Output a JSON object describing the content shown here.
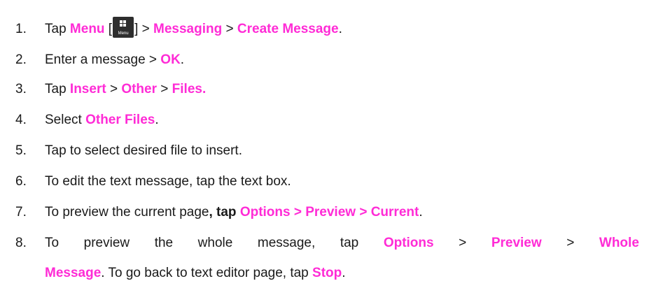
{
  "steps": [
    {
      "n": "1.",
      "t1": "Tap ",
      "h1": "Menu",
      "bl": " [",
      "icon_caption": "Menu",
      "br": "] > ",
      "h2": "Messaging",
      "t2": " > ",
      "h3": "Create Message",
      "t3": "."
    },
    {
      "n": "2.",
      "t1": "Enter a message > ",
      "h1": "OK",
      "t2": "."
    },
    {
      "n": "3.",
      "t1": "Tap ",
      "h1": "Insert",
      "t2": " > ",
      "h2": "Other",
      "t3": " > ",
      "h3": "Files."
    },
    {
      "n": "4.",
      "t1": "Select ",
      "h1": "Other Files",
      "t2": "."
    },
    {
      "n": "5.",
      "t1": "Tap to select desired file to insert."
    },
    {
      "n": "6.",
      "t1": "To edit the text message, tap the text box."
    },
    {
      "n": "7.",
      "t1": "To preview the current page",
      "t1b": ", tap ",
      "h1": "Options > Preview > Current",
      "t2": "."
    },
    {
      "n": "8.",
      "w": [
        "To",
        "preview",
        "the",
        "whole",
        "message,",
        "tap"
      ],
      "h1": "Options",
      "g1": ">",
      "h2": "Preview",
      "g2": ">",
      "h3": "Whole",
      "l2h": "Message",
      "l2t": ". To go back to text editor page, tap ",
      "l2h2": "Stop",
      "l2e": "."
    }
  ],
  "icons": {
    "menu": "windows-menu-grid-icon"
  },
  "colors": {
    "highlight": "#ff2bd6",
    "text": "#1a1a1a",
    "icon_bg": "#2e2e2e"
  }
}
